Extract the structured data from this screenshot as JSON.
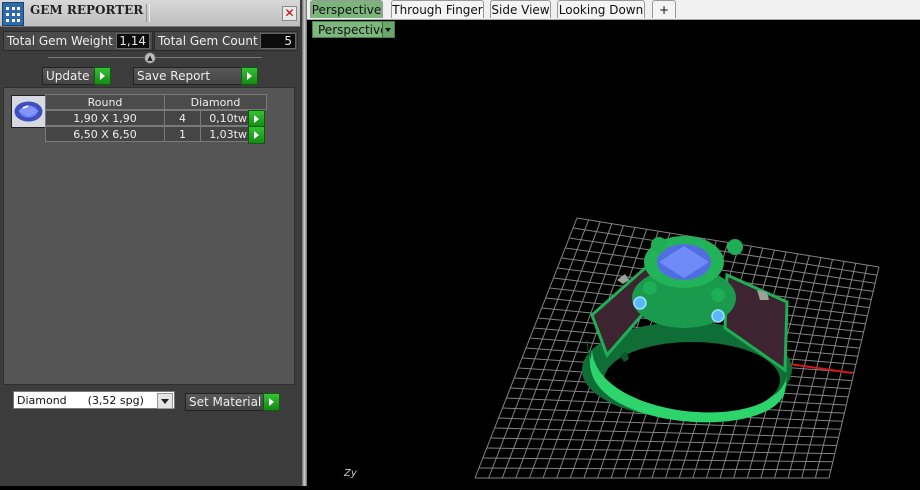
{
  "panel": {
    "title": "GEM REPORTER",
    "close_glyph": "✕",
    "total_gem_weight_label": "Total Gem Weight",
    "total_gem_weight_value": "1,14",
    "total_gem_count_label": "Total Gem Count",
    "total_gem_count_value": "5",
    "update_label": "Update",
    "save_report_label": "Save Report",
    "table": {
      "headers": [
        "Round",
        "Diamond"
      ],
      "rows": [
        {
          "size": "1,90 X 1,90",
          "count": "4",
          "weight": "0,10tw"
        },
        {
          "size": "6,50 X 6,50",
          "count": "1",
          "weight": "1,03tw"
        }
      ]
    },
    "material_select": {
      "selected": "Diamond      (3,52 spg)"
    },
    "set_material_label": "Set Material"
  },
  "viewport": {
    "tabs": [
      "Perspective",
      "Through Finger",
      "Side View",
      "Looking Down",
      "+"
    ],
    "active_tab": "Perspective",
    "view_dropdown": "Perspective",
    "axis_label": "Zy"
  },
  "colors": {
    "accent_green": "#1e9a1e",
    "tab_active": "#7bb57b",
    "ring_green": "#1fae55",
    "gem_blue": "#4f6fe0",
    "grid": "#9a9a9a",
    "axis_x": "#d01818",
    "axis_z": "#18a8d0"
  },
  "icons": [
    "gem-reporter-icon",
    "close-icon",
    "play-arrow-icon",
    "chevron-down-icon",
    "add-tab-icon",
    "gem-thumbnail-icon"
  ]
}
